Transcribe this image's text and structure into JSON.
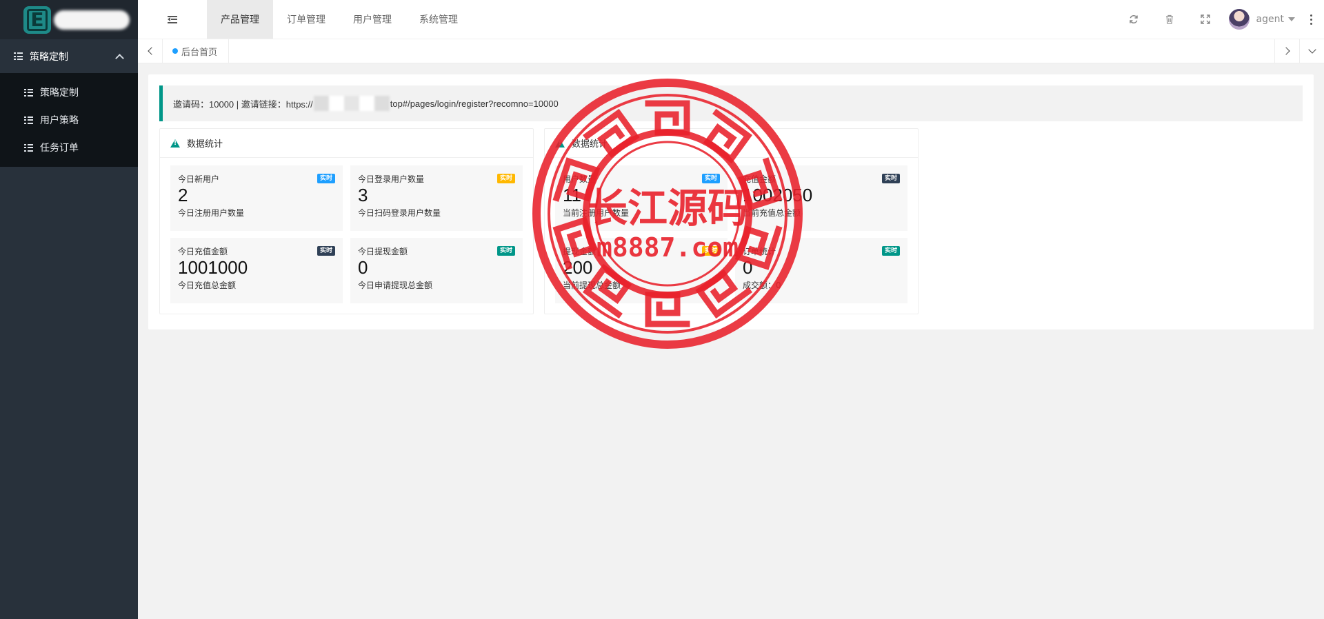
{
  "sidebar": {
    "parent_label": "策略定制",
    "items": [
      {
        "label": "策略定制"
      },
      {
        "label": "用户策略"
      },
      {
        "label": "任务订单"
      }
    ]
  },
  "header": {
    "tabs": [
      {
        "label": "产品管理",
        "active": true
      },
      {
        "label": "订单管理"
      },
      {
        "label": "用户管理"
      },
      {
        "label": "系统管理"
      }
    ],
    "user": "agent",
    "icons": [
      "refresh-icon",
      "trash-icon",
      "fullscreen-icon",
      "more-icon"
    ]
  },
  "tabbar": {
    "home_label": "后台首页"
  },
  "invite": {
    "prefix": "邀请码：10000 | 邀请链接：https://",
    "suffix": "top#/pages/login/register?recomno=10000"
  },
  "panels": [
    {
      "title": "数据统计",
      "cards": [
        {
          "title": "今日新用户",
          "badge": "实时",
          "badge_color": "#1e9fff",
          "value": "2",
          "sub": "今日注册用户数量"
        },
        {
          "title": "今日登录用户数量",
          "badge": "实时",
          "badge_color": "#ffb800",
          "value": "3",
          "sub": "今日扫码登录用户数量"
        },
        {
          "title": "今日充值金额",
          "badge": "实时",
          "badge_color": "#2f4056",
          "value": "1001000",
          "sub": "今日充值总金额"
        },
        {
          "title": "今日提现金额",
          "badge": "实时",
          "badge_color": "#009688",
          "value": "0",
          "sub": "今日申请提现总金额"
        }
      ]
    },
    {
      "title": "数据统计",
      "cards": [
        {
          "title": "用户数量",
          "badge": "实时",
          "badge_color": "#1e9fff",
          "value": "11",
          "sub": "当前注册用户数量"
        },
        {
          "title": "充值金额",
          "badge": "实时",
          "badge_color": "#2f4056",
          "value": "1002050",
          "sub": "当前充值总金额"
        },
        {
          "title": "提现金额",
          "badge": "实时",
          "badge_color": "#ffb800",
          "value": "200",
          "sub": "当前提现总金额"
        },
        {
          "title": "订单统计",
          "badge": "实时",
          "badge_color": "#009688",
          "value": "0",
          "sub": "成交额：0"
        }
      ]
    }
  ],
  "watermark": {
    "title": "长江源码",
    "domain": "m8887.com",
    "color": "#e8202a"
  }
}
